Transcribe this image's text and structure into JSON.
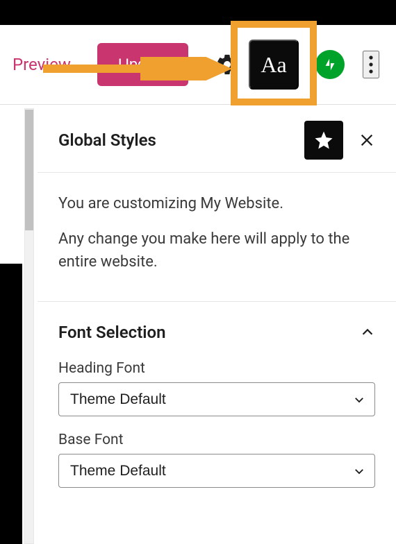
{
  "toolbar": {
    "preview_label": "Preview",
    "update_label": "Update"
  },
  "panel": {
    "title": "Global Styles",
    "desc_line1": "You are customizing My Website.",
    "desc_line2": "Any change you make here will apply to the entire website."
  },
  "font_section": {
    "title": "Font Selection",
    "heading_font_label": "Heading Font",
    "heading_font_value": "Theme Default",
    "base_font_label": "Base Font",
    "base_font_value": "Theme Default"
  },
  "colors": {
    "accent": "#c9356e",
    "highlight": "#f0a02e",
    "jetpack": "#00a32a"
  }
}
